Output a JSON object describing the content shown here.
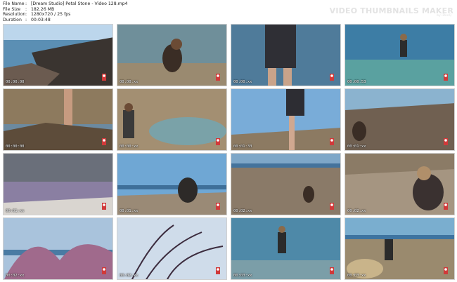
{
  "info": {
    "rows": [
      {
        "key": "File Name",
        "sep": ":",
        "value": "[Dream Studio] Petal Stone - Video 128.mp4"
      },
      {
        "key": "File Size",
        "sep": ":",
        "value": "182.26 MB"
      },
      {
        "key": "Resolution",
        "sep": ":",
        "value": "1280x720 / 25 fps"
      },
      {
        "key": "Duration",
        "sep": ":",
        "value": "00:03:48"
      }
    ]
  },
  "brand": {
    "title": "VIDEO THUMBNAILS MAKER",
    "subtitle": "by iDeeQ"
  },
  "thumbnails": [
    {
      "time": "00:00:00",
      "scene": "rocks-sea"
    },
    {
      "time": "00:00:xx",
      "scene": "crouch-water"
    },
    {
      "time": "00:00:xx",
      "scene": "standing-sea"
    },
    {
      "time": "00:00:53",
      "scene": "wading"
    },
    {
      "time": "00:00:00",
      "scene": "legs-rocks"
    },
    {
      "time": "00:00:xx",
      "scene": "rock-pool"
    },
    {
      "time": "00:01:33",
      "scene": "walk-sky"
    },
    {
      "time": "00:01:xx",
      "scene": "sit-rocks"
    },
    {
      "time": "00:01:xx",
      "scene": "purple-flowers"
    },
    {
      "time": "00:01:xx",
      "scene": "sit-horizon"
    },
    {
      "time": "00:02:xx",
      "scene": "rocky-shore"
    },
    {
      "time": "00:02:xx",
      "scene": "lying-rocks"
    },
    {
      "time": "00:02:xx",
      "scene": "lavender-sky"
    },
    {
      "time": "00:02:xx",
      "scene": "flower-silhouette"
    },
    {
      "time": "00:03:xx",
      "scene": "walk-sea"
    },
    {
      "time": "00:03:xx",
      "scene": "shore-rock"
    }
  ]
}
